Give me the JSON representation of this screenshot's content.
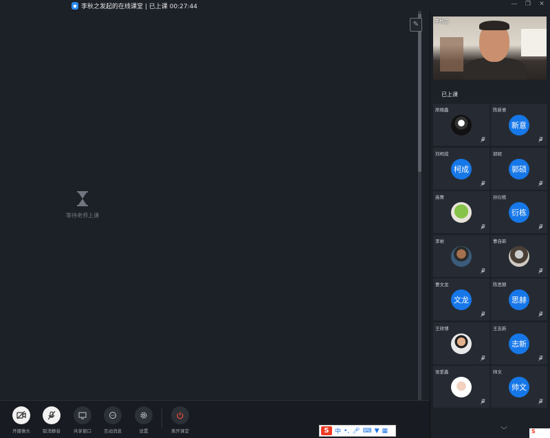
{
  "window": {
    "title": "李秋之发起的在线课堂 | 已上课 00:27:44",
    "controls": [
      "minimize",
      "restore",
      "close"
    ]
  },
  "stage": {
    "waiting_text": "等待老师上课"
  },
  "toolbar": {
    "camera_label": "开摄像头",
    "mute_label": "取消静音",
    "share_label": "共享窗口",
    "chat_label": "互动消息",
    "settings_label": "设置",
    "leave_label": "离开课堂",
    "leave_color": "#e5483a"
  },
  "teacher": {
    "name": "李秋之"
  },
  "participants_header": "已上课",
  "participants": [
    {
      "name": "席楠鑫",
      "avatar_text": "",
      "avatar": "photo"
    },
    {
      "name": "陈新意",
      "avatar_text": "新意",
      "avatar": "text"
    },
    {
      "name": "刘柯成",
      "avatar_text": "柯成",
      "avatar": "text"
    },
    {
      "name": "郭硕",
      "avatar_text": "郭硕",
      "avatar": "text"
    },
    {
      "name": "高菁",
      "avatar_text": "",
      "avatar": "photo"
    },
    {
      "name": "孙衍栋",
      "avatar_text": "衍栋",
      "avatar": "text"
    },
    {
      "name": "李岩",
      "avatar_text": "",
      "avatar": "photo"
    },
    {
      "name": "曹自新",
      "avatar_text": "",
      "avatar": "photo"
    },
    {
      "name": "曹文龙",
      "avatar_text": "文龙",
      "avatar": "text"
    },
    {
      "name": "陈思赫",
      "avatar_text": "思赫",
      "avatar": "text"
    },
    {
      "name": "王祥博",
      "avatar_text": "",
      "avatar": "photo"
    },
    {
      "name": "王志新",
      "avatar_text": "志新",
      "avatar": "text"
    },
    {
      "name": "张爱鑫",
      "avatar_text": "",
      "avatar": "photo"
    },
    {
      "name": "帅文",
      "avatar_text": "帅文",
      "avatar": "text"
    }
  ],
  "ime": {
    "logo": "S",
    "mode": "中"
  },
  "colors": {
    "accent": "#1677e8",
    "background": "#1c2027",
    "tile": "#262b33"
  }
}
